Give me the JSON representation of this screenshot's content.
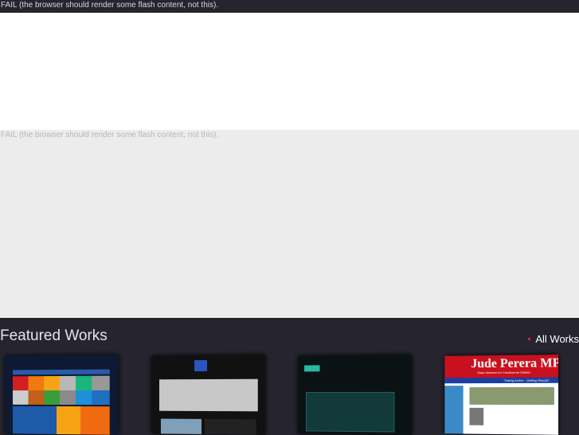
{
  "flash_fallback_top": "FAIL (the browser should render some flash content, not this).",
  "flash_fallback_middle": "FAIL (the browser should render some flash content, not this).",
  "section": {
    "title": "Featured Works",
    "all_works_label": "All Works"
  },
  "works": [
    {
      "name": "Colorful tile website"
    },
    {
      "name": "Dark portfolio website"
    },
    {
      "name": "Studio teal website"
    },
    {
      "name": "Jude Perera MP website",
      "title": "Jude Perera MP",
      "subtitle": "State Member for Cranbourne District",
      "slogan": "\"Taking Action - Getting Results\""
    }
  ],
  "colors": {
    "accent": "#e0203a",
    "background": "#25242f"
  }
}
